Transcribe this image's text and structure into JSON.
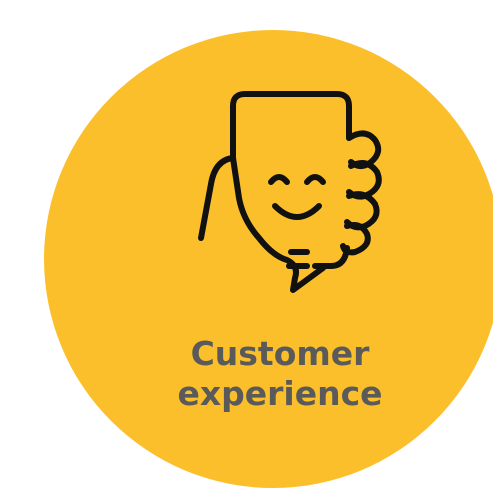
{
  "card": {
    "title_line1": "Customer",
    "title_line2": "experience",
    "icon": "smiling-phone-in-hand-icon",
    "background_color": "#fbbf2b",
    "text_color": "#5a5a5a",
    "icon_color": "#111111"
  }
}
